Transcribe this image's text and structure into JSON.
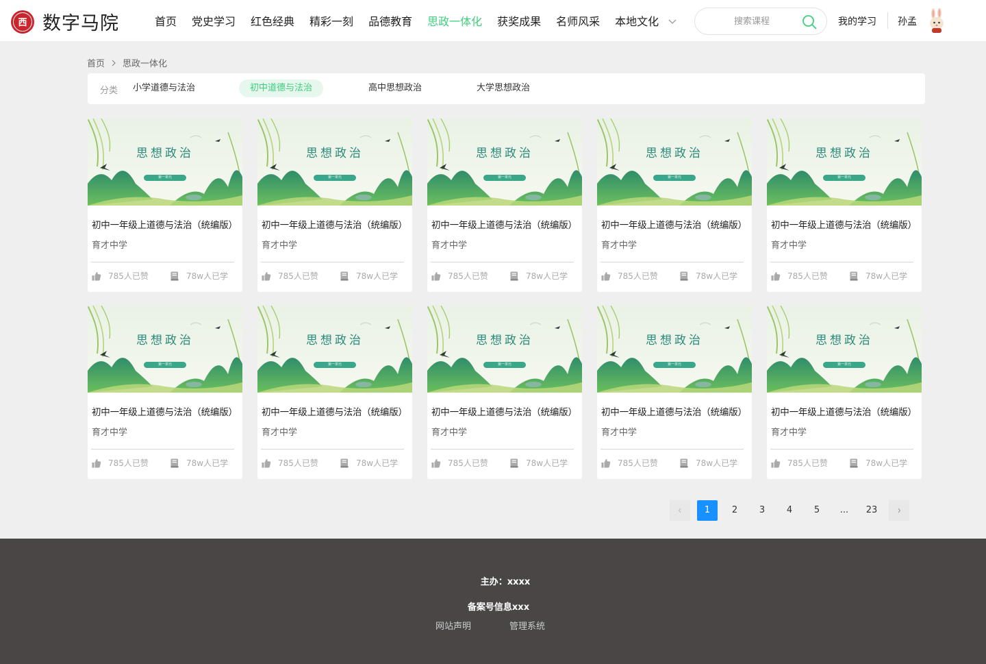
{
  "brand": {
    "seal_glyph": "西",
    "name": "数字马院"
  },
  "nav": {
    "items": [
      {
        "label": "首页",
        "active": false
      },
      {
        "label": "党史学习",
        "active": false
      },
      {
        "label": "红色经典",
        "active": false
      },
      {
        "label": "精彩一刻",
        "active": false
      },
      {
        "label": "品德教育",
        "active": false
      },
      {
        "label": "思政一体化",
        "active": true
      },
      {
        "label": "获奖成果",
        "active": false
      },
      {
        "label": "名师风采",
        "active": false
      },
      {
        "label": "本地文化",
        "active": false
      }
    ],
    "more_icon": "chevron-down-icon"
  },
  "search": {
    "placeholder": "搜索课程",
    "value": "",
    "icon": "search-icon"
  },
  "user": {
    "my_learning": "我的学习",
    "name": "孙孟",
    "avatar_icon": "rabbit-avatar-icon"
  },
  "breadcrumb": {
    "home": "首页",
    "current": "思政一体化"
  },
  "category": {
    "label": "分类",
    "items": [
      {
        "label": "小学道德与法治",
        "active": false
      },
      {
        "label": "初中道德与法治",
        "active": true
      },
      {
        "label": "高中思想政治",
        "active": false
      },
      {
        "label": "大学思想政治",
        "active": false
      }
    ]
  },
  "courses": [
    {
      "cover_text": "思想政治",
      "cover_tag": "第一单元",
      "title": "初中一年级上道德与法治（统编版）",
      "school": "育才中学",
      "likes": "785人已赞",
      "learners": "78w人已学"
    },
    {
      "cover_text": "思想政治",
      "cover_tag": "第一单元",
      "title": "初中一年级上道德与法治（统编版）",
      "school": "育才中学",
      "likes": "785人已赞",
      "learners": "78w人已学"
    },
    {
      "cover_text": "思想政治",
      "cover_tag": "第一单元",
      "title": "初中一年级上道德与法治（统编版）",
      "school": "育才中学",
      "likes": "785人已赞",
      "learners": "78w人已学"
    },
    {
      "cover_text": "思想政治",
      "cover_tag": "第一单元",
      "title": "初中一年级上道德与法治（统编版）",
      "school": "育才中学",
      "likes": "785人已赞",
      "learners": "78w人已学"
    },
    {
      "cover_text": "思想政治",
      "cover_tag": "第一单元",
      "title": "初中一年级上道德与法治（统编版）",
      "school": "育才中学",
      "likes": "785人已赞",
      "learners": "78w人已学"
    },
    {
      "cover_text": "思想政治",
      "cover_tag": "第一单元",
      "title": "初中一年级上道德与法治（统编版）",
      "school": "育才中学",
      "likes": "785人已赞",
      "learners": "78w人已学"
    },
    {
      "cover_text": "思想政治",
      "cover_tag": "第一单元",
      "title": "初中一年级上道德与法治（统编版）",
      "school": "育才中学",
      "likes": "785人已赞",
      "learners": "78w人已学"
    },
    {
      "cover_text": "思想政治",
      "cover_tag": "第一单元",
      "title": "初中一年级上道德与法治（统编版）",
      "school": "育才中学",
      "likes": "785人已赞",
      "learners": "78w人已学"
    },
    {
      "cover_text": "思想政治",
      "cover_tag": "第一单元",
      "title": "初中一年级上道德与法治（统编版）",
      "school": "育才中学",
      "likes": "785人已赞",
      "learners": "78w人已学"
    },
    {
      "cover_text": "思想政治",
      "cover_tag": "第一单元",
      "title": "初中一年级上道德与法治（统编版）",
      "school": "育才中学",
      "likes": "785人已赞",
      "learners": "78w人已学"
    }
  ],
  "pagination": {
    "prev_icon": "chevron-left-icon",
    "next_icon": "chevron-right-icon",
    "pages": [
      "1",
      "2",
      "3",
      "4",
      "5",
      "...",
      "23"
    ],
    "current": "1"
  },
  "footer": {
    "organizer": "主办：xxxx",
    "icp": "备案号信息xxx",
    "links": [
      "网站声明",
      "管理系统"
    ]
  },
  "colors": {
    "accent_green": "#3ecf7d",
    "page_active_blue": "#1890ff",
    "footer_bg": "#4a4646",
    "seal_red": "#c8252c"
  }
}
